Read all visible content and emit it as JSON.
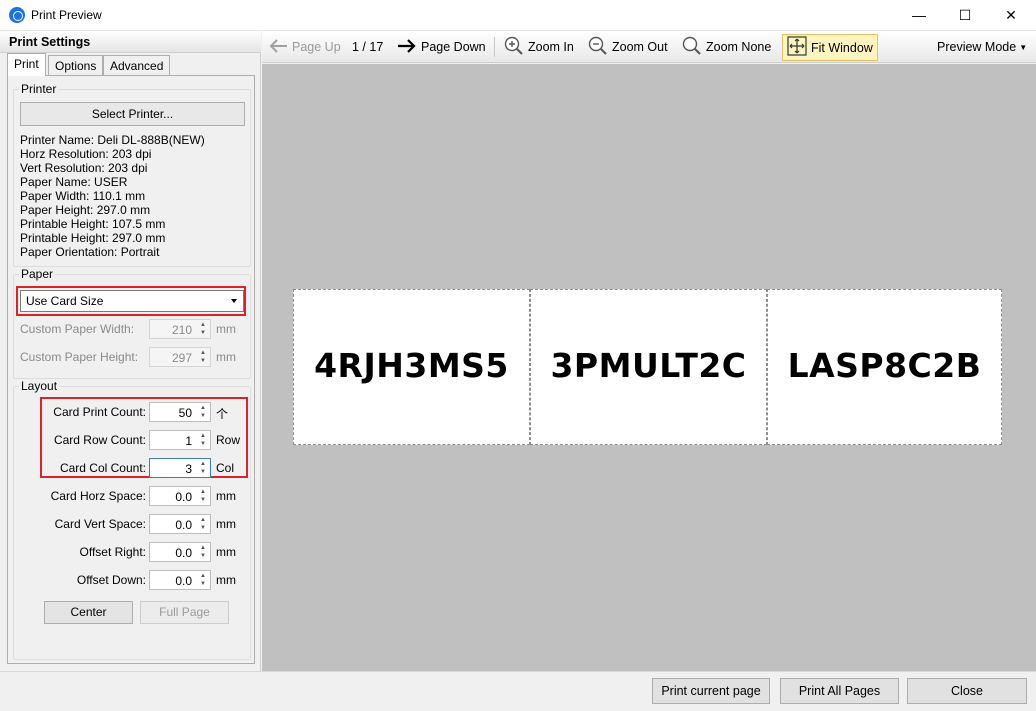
{
  "window": {
    "title": "Print Preview",
    "minimize": "—",
    "maximize": "☐",
    "close": "✕"
  },
  "settings": {
    "title": "Print Settings",
    "tabs": [
      "Print",
      "Options",
      "Advanced"
    ],
    "printer_group": {
      "title": "Printer",
      "select_button": "Select Printer...",
      "info": [
        "Printer Name: Deli DL-888B(NEW)",
        "Horz Resolution: 203 dpi",
        "Vert Resolution: 203 dpi",
        "Paper Name: USER",
        "Paper Width: 110.1 mm",
        "Paper Height: 297.0 mm",
        "Printable Height: 107.5 mm",
        "Printable Height: 297.0 mm",
        "Paper Orientation: Portrait"
      ]
    },
    "paper_group": {
      "title": "Paper",
      "size_option": "Use Card Size",
      "custom_width_label": "Custom Paper Width:",
      "custom_width_value": "210",
      "custom_width_unit": "mm",
      "custom_height_label": "Custom Paper Height:",
      "custom_height_value": "297",
      "custom_height_unit": "mm"
    },
    "layout_group": {
      "title": "Layout",
      "fields": [
        {
          "label": "Card Print Count:",
          "value": "50",
          "unit": "个"
        },
        {
          "label": "Card Row Count:",
          "value": "1",
          "unit": "Row"
        },
        {
          "label": "Card Col Count:",
          "value": "3",
          "unit": "Col"
        },
        {
          "label": "Card Horz Space:",
          "value": "0.0",
          "unit": "mm"
        },
        {
          "label": "Card Vert Space:",
          "value": "0.0",
          "unit": "mm"
        },
        {
          "label": "Offset Right:",
          "value": "0.0",
          "unit": "mm"
        },
        {
          "label": "Offset Down:",
          "value": "0.0",
          "unit": "mm"
        }
      ],
      "center_button": "Center",
      "full_page_button": "Full Page"
    }
  },
  "toolbar": {
    "page_up": "Page Up",
    "page_info": "1 / 17",
    "page_down": "Page Down",
    "zoom_in": "Zoom In",
    "zoom_out": "Zoom Out",
    "zoom_none": "Zoom None",
    "fit_window": "Fit Window",
    "preview_mode": "Preview Mode"
  },
  "preview": {
    "cards": [
      "4RJH3MS5",
      "3PMULT2C",
      "LASP8C2B"
    ]
  },
  "bottom": {
    "print_current": "Print current page",
    "print_all": "Print All Pages",
    "close": "Close"
  },
  "colors": {
    "highlight_red": "#d9252a",
    "fit_window_bg": "#fdf4bf",
    "preview_bg": "#c0c0c0",
    "app_icon": "#1a73e8"
  }
}
